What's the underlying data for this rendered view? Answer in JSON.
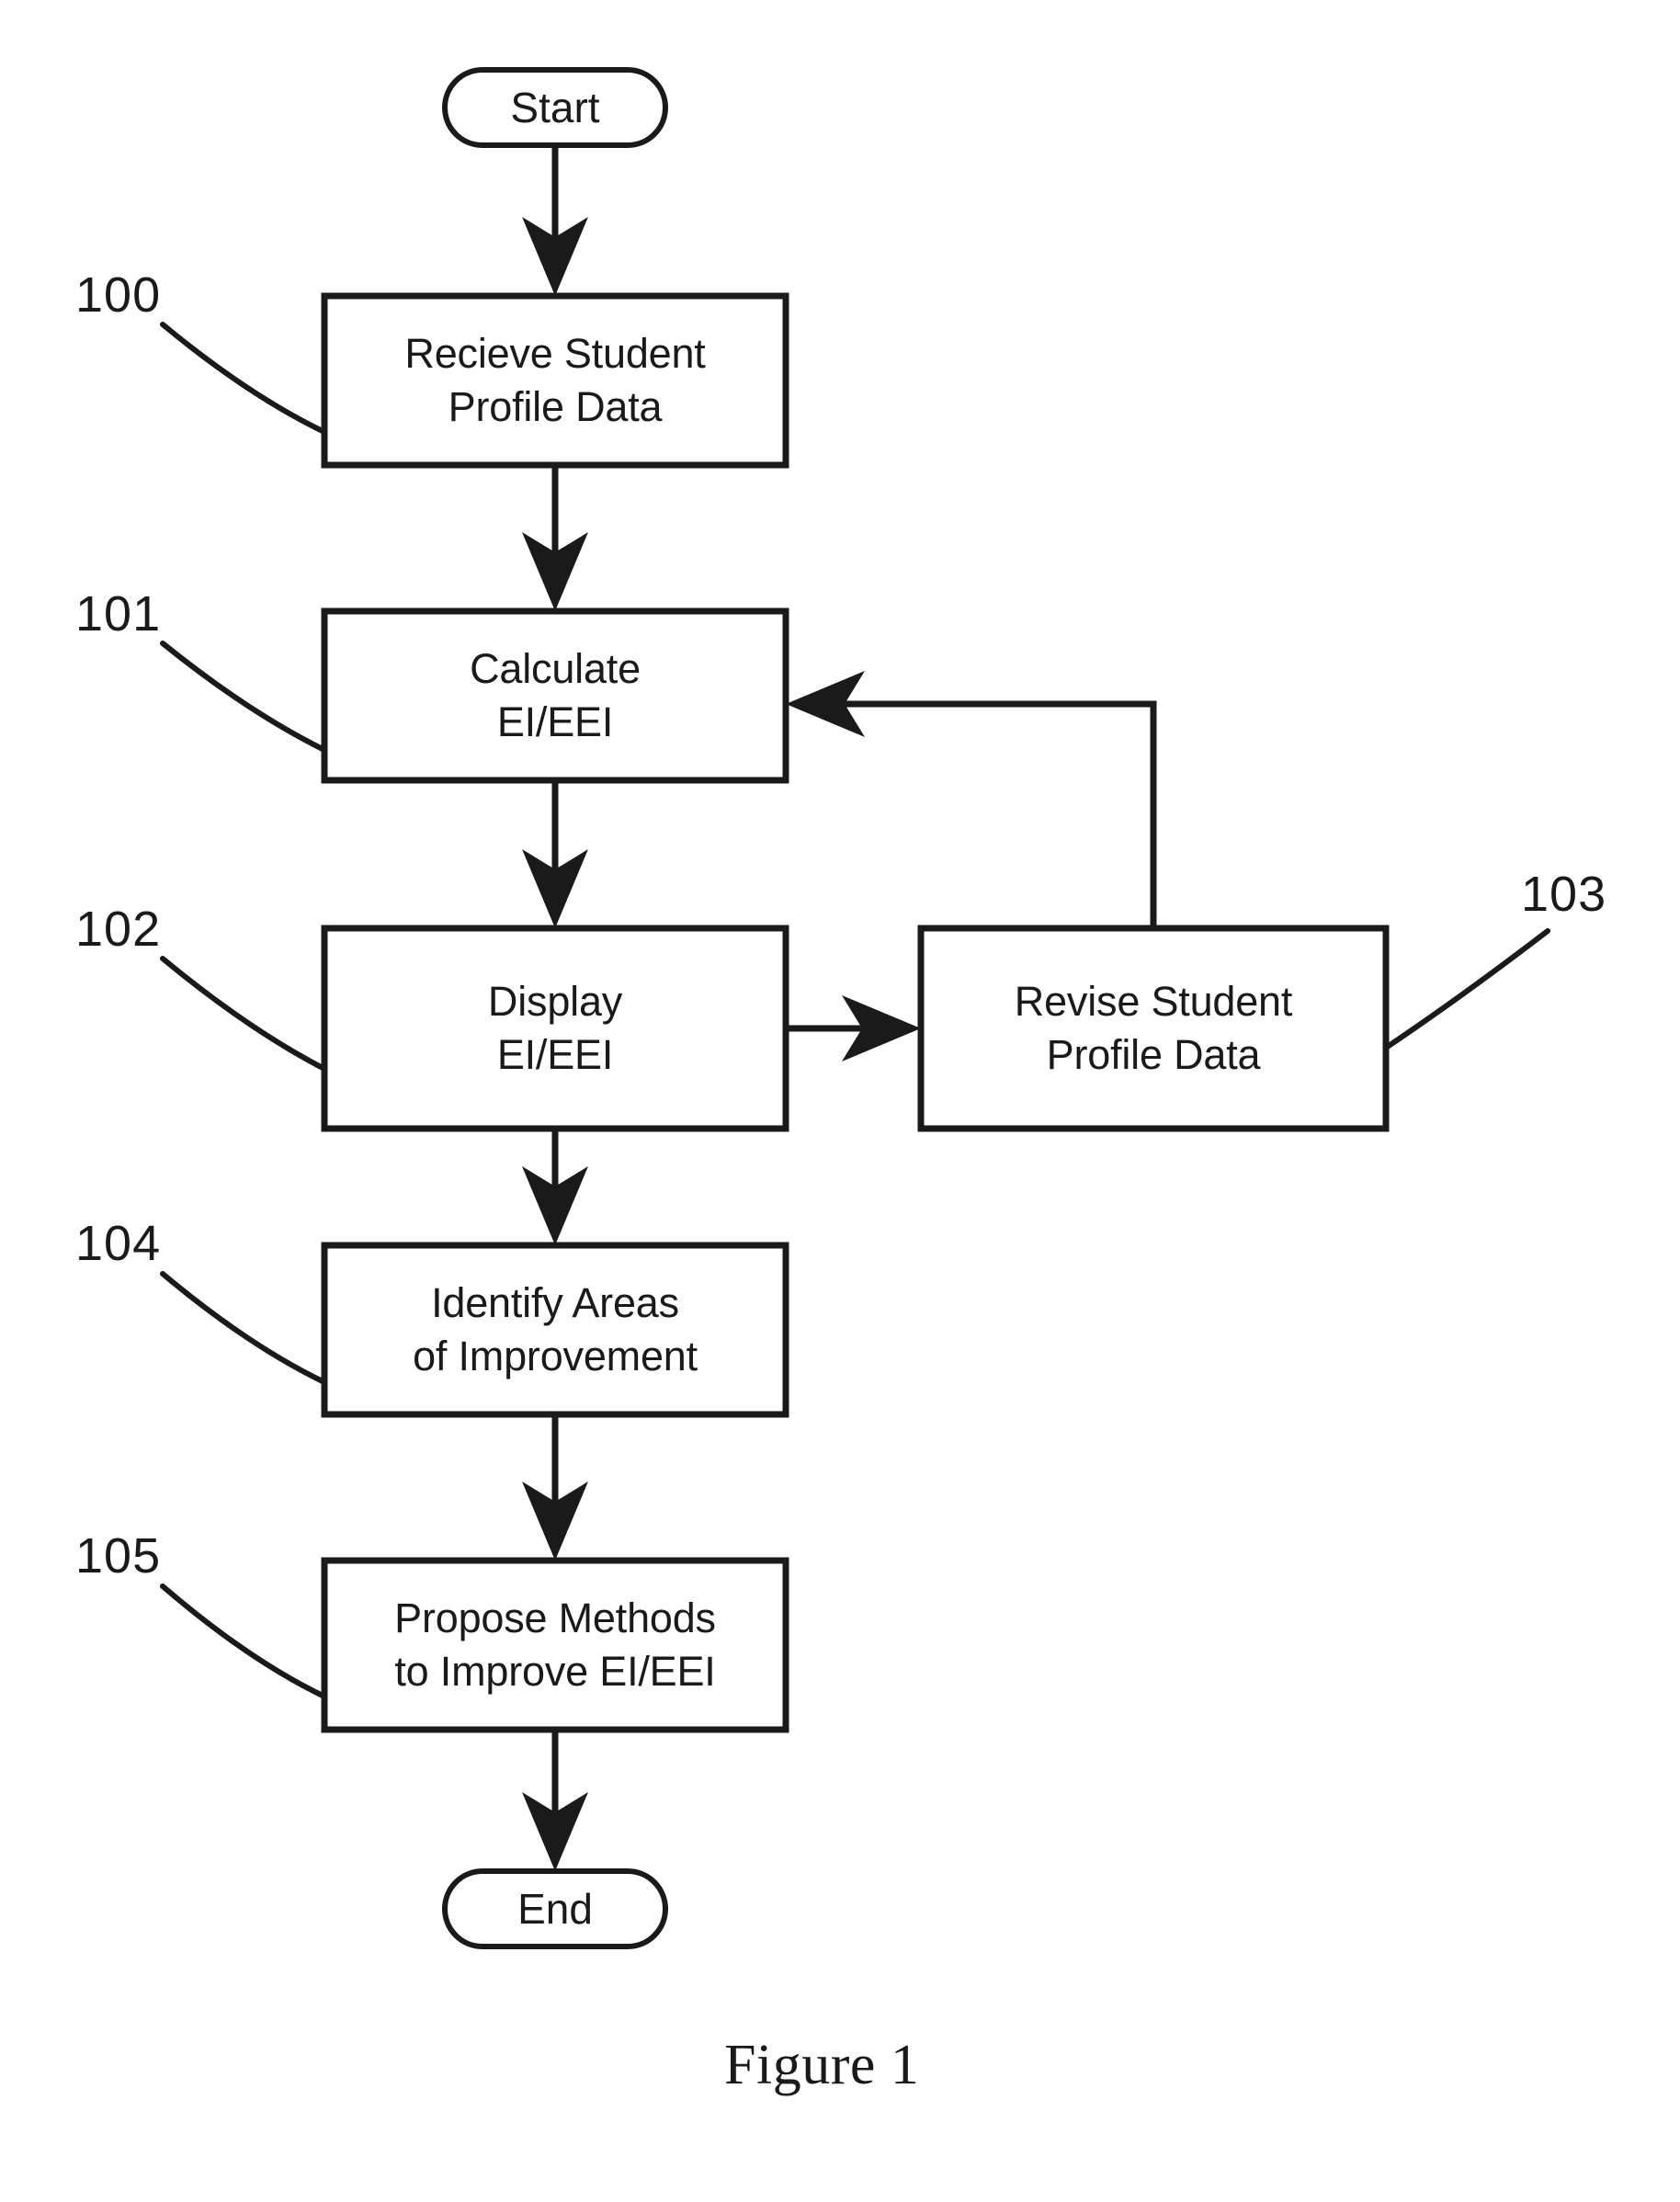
{
  "figure": {
    "caption": "Figure 1"
  },
  "flowchart": {
    "terminators": {
      "start": "Start",
      "end": "End"
    },
    "nodes": [
      {
        "ref": "100",
        "line1": "Recieve Student",
        "line2": "Profile Data"
      },
      {
        "ref": "101",
        "line1": "Calculate",
        "line2": "EI/EEI"
      },
      {
        "ref": "102",
        "line1": "Display",
        "line2": "EI/EEI"
      },
      {
        "ref": "103",
        "line1": "Revise Student",
        "line2": "Profile Data"
      },
      {
        "ref": "104",
        "line1": "Identify Areas",
        "line2": "of Improvement"
      },
      {
        "ref": "105",
        "line1": "Propose Methods",
        "line2": "to Improve EI/EEI"
      }
    ],
    "colors": {
      "ink": "#1a1a1a",
      "background": "#ffffff"
    }
  }
}
